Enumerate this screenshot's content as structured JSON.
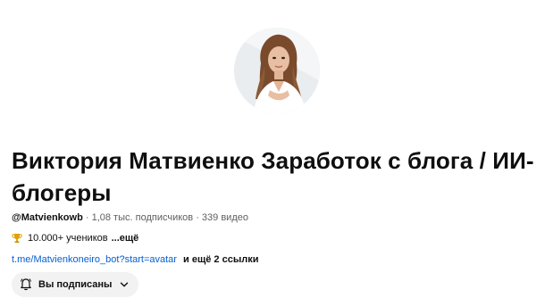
{
  "channel": {
    "title": "Виктория Матвиенко Заработок с блога / ИИ-блогеры",
    "handle": "@Matvienkowb",
    "sep1": "·",
    "subscribers": "1,08 тыс. подписчиков",
    "sep2": "·",
    "videos": "339 видео",
    "description": "10.000+ учеников",
    "description_more": "...ещё",
    "link": "t.me/Matvienkoneiro_bot?start=avatar",
    "links_more": "и ещё 2 ссылки",
    "subscribe_label": "Вы подписаны"
  },
  "icons": {
    "avatar": "channel-avatar",
    "trophy": "trophy-icon",
    "bell": "bell-icon",
    "chevron": "chevron-down-icon"
  },
  "colors": {
    "link": "#065fd4",
    "button_bg": "#f2f2f2",
    "meta_text": "#606060"
  }
}
